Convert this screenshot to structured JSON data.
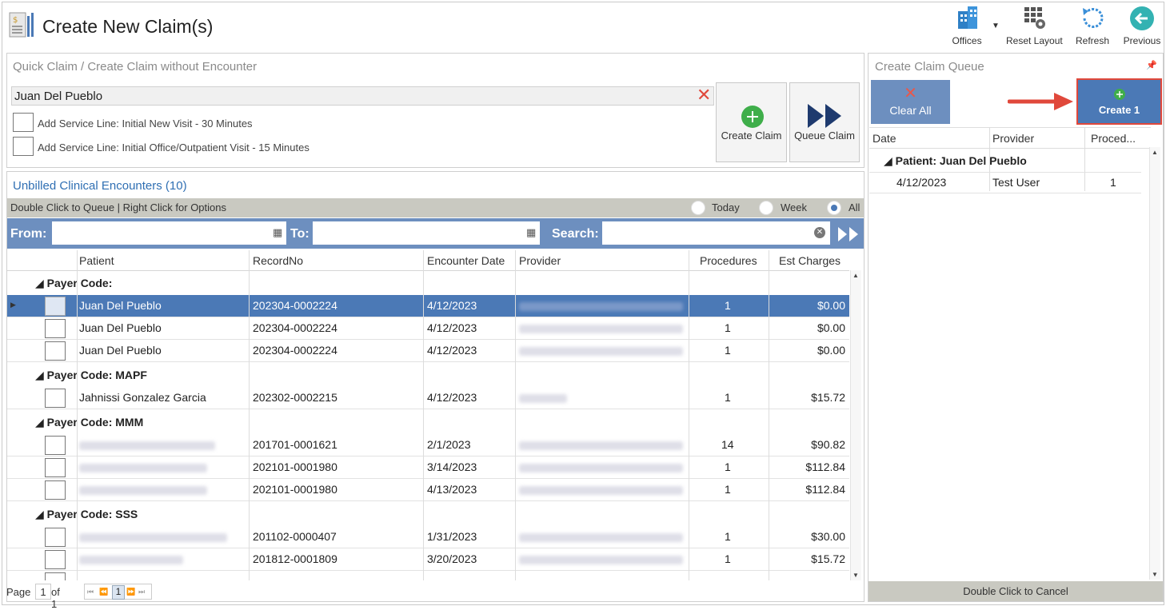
{
  "window": {
    "title": "Create New Claim(s)"
  },
  "toolbar": {
    "offices": "Offices",
    "reset_layout": "Reset Layout",
    "refresh": "Refresh",
    "previous": "Previous"
  },
  "quick_claim": {
    "title": "Quick Claim / Create Claim without Encounter",
    "patient_value": "Juan Del Pueblo",
    "service_line_1": "Add Service Line: Initial New Visit - 30 Minutes",
    "service_line_2": "Add Service Line: Initial Office/Outpatient Visit - 15 Minutes",
    "create_claim": "Create Claim",
    "queue_claim": "Queue Claim"
  },
  "encounters": {
    "title": "Unbilled Clinical Encounters (10)",
    "hint": "Double Click to Queue | Right Click for Options",
    "filter_today": "Today",
    "filter_week": "Week",
    "filter_all": "All",
    "from_label": "From:",
    "to_label": "To:",
    "search_label": "Search:",
    "columns": [
      "Patient",
      "RecordNo",
      "Encounter Date",
      "Provider",
      "Procedures",
      "Est Charges"
    ],
    "groups": [
      "Payer Code:",
      "Payer Code: MAPF",
      "Payer Code: MMM",
      "Payer Code: SSS"
    ],
    "rows": [
      {
        "patient": "Juan  Del Pueblo",
        "record": "202304-0002224",
        "date": "4/12/2023",
        "procedures": "1",
        "charges": "$0.00"
      },
      {
        "patient": "Juan  Del Pueblo",
        "record": "202304-0002224",
        "date": "4/12/2023",
        "procedures": "1",
        "charges": "$0.00"
      },
      {
        "patient": "Juan  Del Pueblo",
        "record": "202304-0002224",
        "date": "4/12/2023",
        "procedures": "1",
        "charges": "$0.00"
      },
      {
        "patient": "Jahnissi Gonzalez  Garcia",
        "record": "202302-0002215",
        "date": "4/12/2023",
        "procedures": "1",
        "charges": "$15.72"
      },
      {
        "patient": "",
        "record": "201701-0001621",
        "date": "2/1/2023",
        "procedures": "14",
        "charges": "$90.82"
      },
      {
        "patient": "",
        "record": "202101-0001980",
        "date": "3/14/2023",
        "procedures": "1",
        "charges": "$112.84"
      },
      {
        "patient": "",
        "record": "202101-0001980",
        "date": "4/13/2023",
        "procedures": "1",
        "charges": "$112.84"
      },
      {
        "patient": "",
        "record": "201102-0000407",
        "date": "1/31/2023",
        "procedures": "1",
        "charges": "$30.00"
      },
      {
        "patient": "",
        "record": "201812-0001809",
        "date": "3/20/2023",
        "procedures": "1",
        "charges": "$15.72"
      }
    ],
    "pager": {
      "page_label": "Page",
      "page": "1",
      "of_label": "of 1",
      "current": "1"
    }
  },
  "queue": {
    "title": "Create Claim Queue",
    "clear_all": "Clear All",
    "create": "Create 1",
    "columns": [
      "Date",
      "Provider",
      "Proced..."
    ],
    "group": "Patient: Juan  Del Pueblo",
    "row": {
      "date": "4/12/2023",
      "provider": "Test User",
      "procedures": "1"
    },
    "footer": "Double Click to Cancel"
  },
  "colors": {
    "accent": "#4b79b6",
    "header_bar": "#6d8fbf",
    "toolbar_strip": "#c9c9c1",
    "highlight": "#e0483b"
  }
}
